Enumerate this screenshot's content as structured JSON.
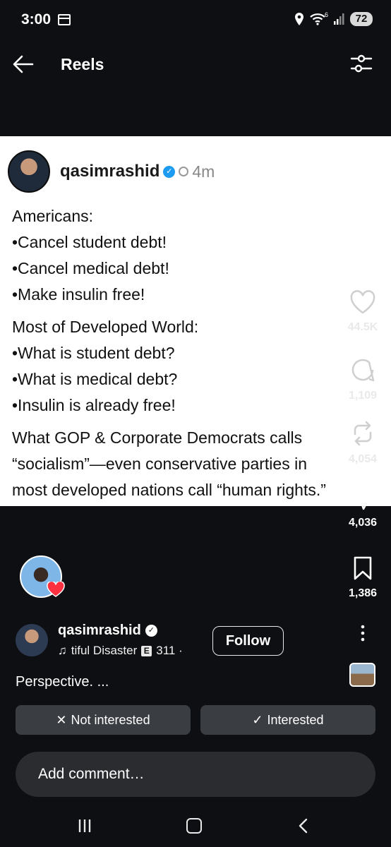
{
  "status_bar": {
    "time": "3:00",
    "battery": "72",
    "network": "6"
  },
  "header": {
    "title": "Reels"
  },
  "post": {
    "username": "qasimrashid",
    "time_ago": "4m",
    "lines": [
      "Americans:",
      "•Cancel student debt!",
      "•Cancel medical debt!",
      "•Make insulin free!",
      "Most of Developed World:",
      "•What is student debt?",
      "•What is medical debt?",
      "•Insulin is already free!",
      "What GOP & Corporate Democrats calls",
      "“socialism”—even conservative parties in",
      "most developed nations call “human rights.”"
    ]
  },
  "actions": {
    "likes": "44.5K",
    "comments": "1,109",
    "reposts": "4,054",
    "shares": "4,036",
    "saves": "1,386"
  },
  "author": {
    "name": "qasimrashid",
    "audio_title": "tiful Disaster",
    "explicit": "E",
    "audio_count": "311 ·",
    "follow_label": "Follow",
    "caption": "Perspective. ..."
  },
  "feedback": {
    "not_interested": "Not interested",
    "interested": "Interested"
  },
  "comment": {
    "placeholder": "Add comment…"
  },
  "colors": {
    "background": "#0d0f12",
    "verified": "#1d9bf0",
    "heart": "#ff3040"
  }
}
